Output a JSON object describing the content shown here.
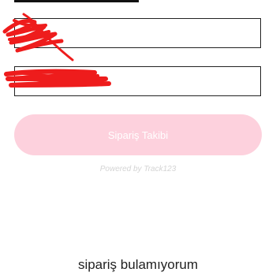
{
  "form": {
    "order_field_value": "",
    "email_field_value": "",
    "submit_label": "Sipariş Takibi",
    "powered_by": "Powered by Track123"
  },
  "result": {
    "message": "sipariş bulamıyorum"
  },
  "colors": {
    "button_bg": "#fdd1dd",
    "button_text": "#ffffff",
    "redaction": "#ee1c1c",
    "field_border": "#222222"
  }
}
